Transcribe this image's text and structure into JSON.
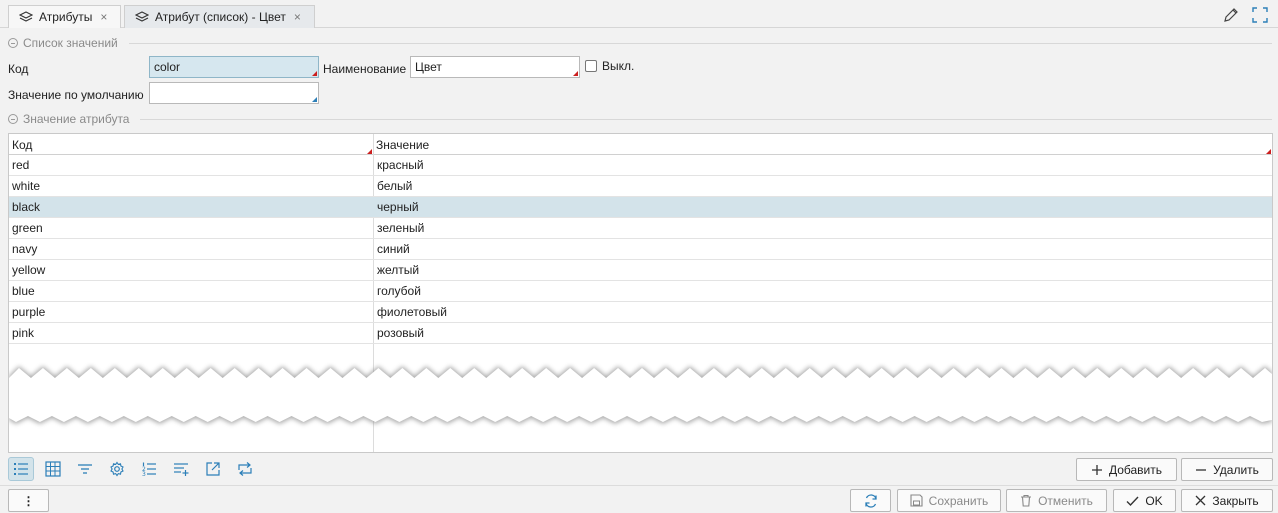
{
  "tabs": [
    {
      "label": "Атрибуты",
      "icon": "layers-icon",
      "close": "×"
    },
    {
      "label": "Атрибут (список) - Цвет",
      "icon": "layers-icon",
      "close": "×"
    }
  ],
  "toolbar_right": {
    "edit_icon": "pencil-icon",
    "fullscreen_icon": "fullscreen-icon"
  },
  "section_values": {
    "title": "Список значений"
  },
  "form": {
    "code_label": "Код",
    "code_value": "color",
    "name_label": "Наименование",
    "name_value": "Цвет",
    "disabled_label": "Выкл.",
    "default_label": "Значение по умолчанию",
    "default_value": ""
  },
  "section_attr": {
    "title": "Значение атрибута"
  },
  "table": {
    "columns": [
      "Код",
      "Значение"
    ],
    "rows": [
      {
        "code": "red",
        "value": "красный"
      },
      {
        "code": "white",
        "value": "белый"
      },
      {
        "code": "black",
        "value": "черный",
        "selected": true
      },
      {
        "code": "green",
        "value": "зеленый"
      },
      {
        "code": "navy",
        "value": "синий"
      },
      {
        "code": "yellow",
        "value": "желтый"
      },
      {
        "code": "blue",
        "value": "голубой"
      },
      {
        "code": "purple",
        "value": "фиолетовый"
      },
      {
        "code": "pink",
        "value": "розовый"
      }
    ]
  },
  "grid_tools": [
    "list-view-icon",
    "table-view-icon",
    "filter-icon",
    "settings-icon",
    "numbered-list-icon",
    "add-rows-icon",
    "export-icon",
    "transfer-icon"
  ],
  "actions": {
    "add": "Добавить",
    "delete": "Удалить"
  },
  "footer": {
    "menu": "⋮",
    "refresh_icon": "refresh-icon",
    "save": "Сохранить",
    "cancel": "Отменить",
    "ok": "OK",
    "close": "Закрыть"
  },
  "colors": {
    "selection": "#d3e3ea",
    "required_marker": "#cc1f1f",
    "accent": "#2c7fb8"
  }
}
